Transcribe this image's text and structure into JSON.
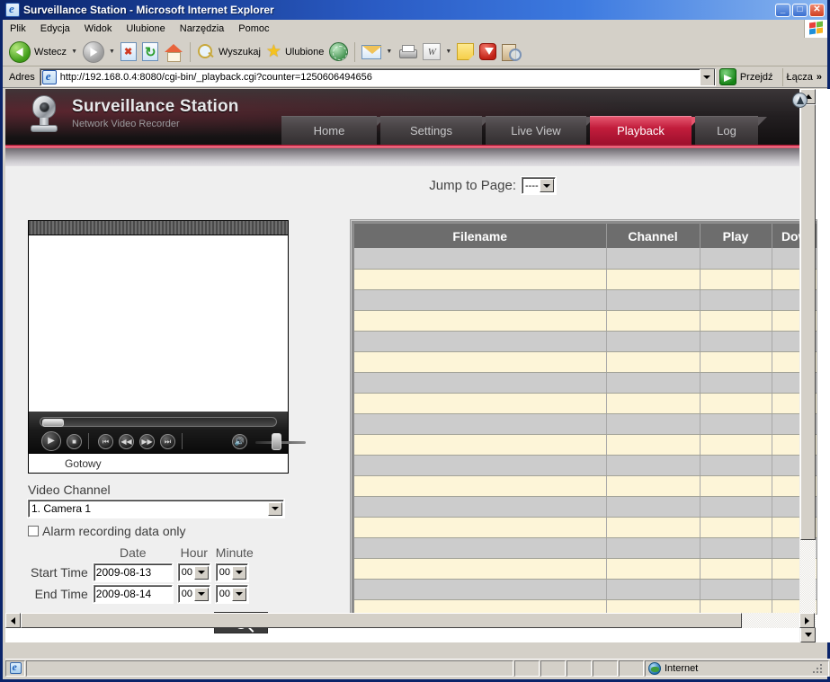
{
  "window": {
    "title": "Surveillance Station - Microsoft Internet Explorer",
    "minimize_label": "_",
    "maximize_label": "□",
    "close_label": "✕"
  },
  "menubar": {
    "items": [
      "Plik",
      "Edycja",
      "Widok",
      "Ulubione",
      "Narzędzia",
      "Pomoc"
    ]
  },
  "toolbar": {
    "back_label": "Wstecz",
    "search_label": "Wyszukaj",
    "favorites_label": "Ulubione",
    "word_icon_label": "W"
  },
  "addressbar": {
    "label": "Adres",
    "url": "http://192.168.0.4:8080/cgi-bin/_playback.cgi?counter=1250606494656",
    "go_label": "Przejdź",
    "links_label": "Łącza",
    "links_chevron": "»"
  },
  "site": {
    "brand_title": "Surveillance Station",
    "brand_subtitle": "Network Video Recorder",
    "tabs": [
      {
        "id": "home",
        "label": "Home",
        "active": false
      },
      {
        "id": "settings",
        "label": "Settings",
        "active": false
      },
      {
        "id": "liveview",
        "label": "Live View",
        "active": false
      },
      {
        "id": "playback",
        "label": "Playback",
        "active": true
      },
      {
        "id": "log",
        "label": "Log",
        "active": false
      }
    ],
    "accent_color": "#c21d3c",
    "header_bg": "#231f21"
  },
  "content": {
    "jump_to_page_label": "Jump to Page:",
    "jump_to_page_value": "----",
    "player": {
      "status_text": "Gotowy",
      "play_icon": "▶",
      "stop_icon": "■",
      "prev_icon": "⏮",
      "rewind_icon": "◀◀",
      "forward_icon": "▶▶",
      "next_icon": "⏭",
      "mute_icon": "🔊"
    },
    "form": {
      "video_channel_label": "Video Channel",
      "video_channel_value": "1. Camera 1",
      "alarm_only_label": "Alarm recording data only",
      "alarm_only_checked": false,
      "col_date": "Date",
      "col_hour": "Hour",
      "col_minute": "Minute",
      "start_time_label": "Start Time",
      "start_date_value": "2009-08-13",
      "start_hour_value": "00",
      "start_minute_value": "00",
      "end_time_label": "End Time",
      "end_date_value": "2009-08-14",
      "end_hour_value": "00",
      "end_minute_value": "00",
      "search_button_icon": "search-icon"
    },
    "table": {
      "columns": [
        "Filename",
        "Channel",
        "Play",
        "Down"
      ],
      "row_count": 20,
      "rows": [],
      "row_color_odd": "#cccccc",
      "row_color_even": "#fdf5d8",
      "header_bg": "#6d6d6d"
    }
  },
  "statusbar": {
    "zone_label": "Internet"
  }
}
